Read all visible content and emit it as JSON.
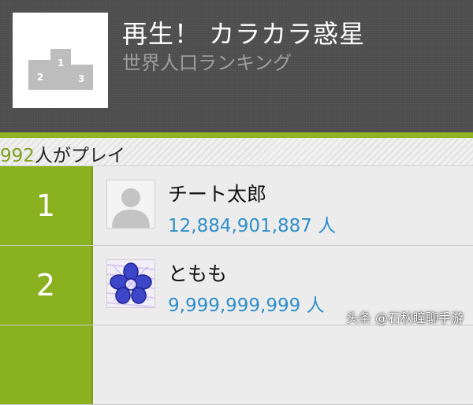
{
  "header": {
    "title": "再生！ カラカラ惑星",
    "subtitle": "世界人口ランキング",
    "podium_labels": [
      "1",
      "2",
      "3"
    ]
  },
  "players": {
    "count": "992",
    "suffix": "人がプレイ"
  },
  "ranking": [
    {
      "rank": "1",
      "name": "チート太郎",
      "population": "12,884,901,887 人",
      "avatar_icon": "default-person-icon"
    },
    {
      "rank": "2",
      "name": "ともも",
      "population": "9,999,999,999 人",
      "avatar_icon": "blue-flower-drawing-icon"
    }
  ],
  "watermark": "头条 @石秋瞳聊手游",
  "colors": {
    "accent_green": "#8ab11f",
    "population_blue": "#2f8fc8",
    "count_green": "#7fa01c",
    "header_bg": "#4f4f4f"
  }
}
